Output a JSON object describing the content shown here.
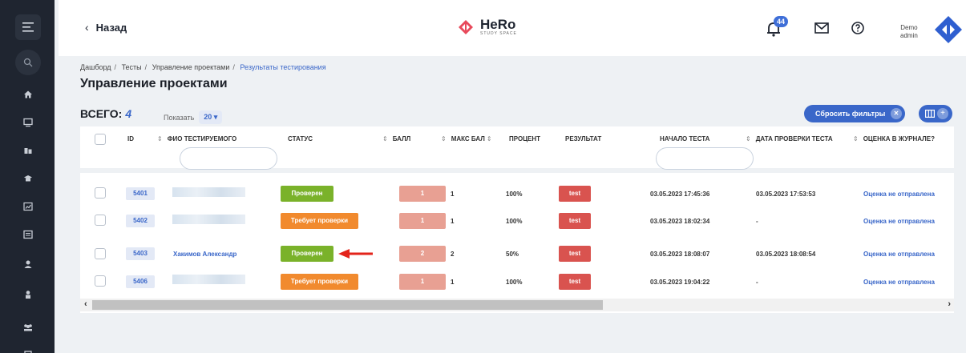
{
  "header": {
    "back_label": "Назад",
    "brand_name": "HeRo",
    "brand_sub": "STUDY SPACE",
    "notifications_count": "44",
    "user_line1": "Demo",
    "user_line2": "admin"
  },
  "breadcrumb": [
    "Дашборд",
    "Тесты",
    "Управление проектами",
    "Результаты тестирования"
  ],
  "page_title": "Управление проектами",
  "toolbar": {
    "total_label": "ВСЕГО:",
    "total_value": "4",
    "show_label": "Показать",
    "show_value": "20",
    "reset_filters_label": "Сбросить фильтры"
  },
  "columns": {
    "id": "ID",
    "name": "ФИО ТЕСТИРУЕМОГО",
    "status": "СТАТУС",
    "score": "БАЛЛ",
    "max_score": "МАКС БАЛ",
    "percent": "ПРОЦЕНТ",
    "result": "РЕЗУЛЬТАТ",
    "start": "НАЧАЛО ТЕСТА",
    "check_date": "ДАТА ПРОВЕРКИ ТЕСТА",
    "journal": "ОЦЕНКА В ЖУРНАЛЕ?"
  },
  "rows": [
    {
      "id": "5401",
      "name": "",
      "status": "Проверен",
      "score": "1",
      "max_score": "1",
      "percent": "100%",
      "result": "test",
      "start": "03.05.2023 17:45:36",
      "check_date": "03.05.2023 17:53:53",
      "journal": "Оценка не отправлена"
    },
    {
      "id": "5402",
      "name": "",
      "status": "Требует проверки",
      "score": "1",
      "max_score": "1",
      "percent": "100%",
      "result": "test",
      "start": "03.05.2023 18:02:34",
      "check_date": "-",
      "journal": "Оценка не отправлена"
    },
    {
      "id": "5403",
      "name": "Хакимов Александр",
      "status": "Проверен",
      "score": "2",
      "max_score": "2",
      "percent": "50%",
      "result": "test",
      "start": "03.05.2023 18:08:07",
      "check_date": "03.05.2023 18:08:54",
      "journal": "Оценка не отправлена"
    },
    {
      "id": "5406",
      "name": "",
      "status": "Требует проверки",
      "score": "1",
      "max_score": "1",
      "percent": "100%",
      "result": "test",
      "start": "03.05.2023 19:04:22",
      "check_date": "-",
      "journal": "Оценка не отправлена"
    }
  ],
  "colors": {
    "accent": "#3a67c9",
    "checked": "#7ab22a",
    "pending": "#f18a2e",
    "result": "#d9534f",
    "score": "#e8a093",
    "sidebar": "#1f2530"
  }
}
